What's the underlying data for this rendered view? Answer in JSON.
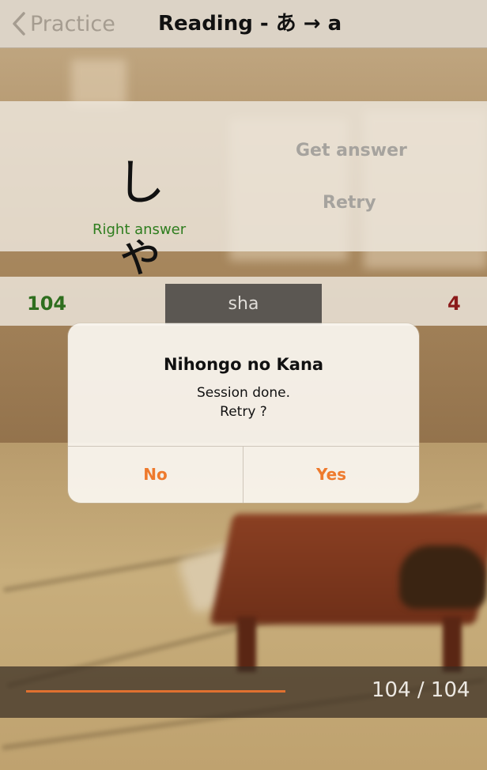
{
  "nav": {
    "back_label": "Practice",
    "title": "Reading - あ → a"
  },
  "card": {
    "kana": "しゃ",
    "feedback": "Right answer",
    "get_answer_label": "Get answer",
    "retry_label": "Retry"
  },
  "score": {
    "correct": "104",
    "wrong": "4",
    "answer": "sha"
  },
  "dialog": {
    "title": "Nihongo no Kana",
    "message_line1": "Session done.",
    "message_line2": "Retry ?",
    "no_label": "No",
    "yes_label": "Yes"
  },
  "progress": {
    "text": "104 / 104",
    "fraction": 1.0
  },
  "colors": {
    "accent": "#ee7a2d",
    "correct": "#2e7d1e",
    "wrong": "#8b1a1a"
  }
}
